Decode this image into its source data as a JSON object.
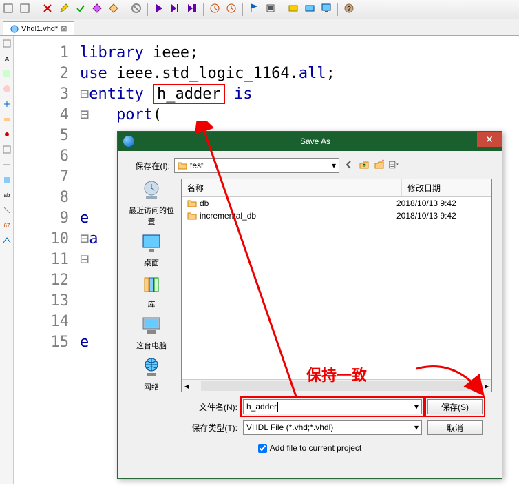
{
  "tab": {
    "label": "Vhdl1.vhd*"
  },
  "lines": {
    "nums": [
      "1",
      "2",
      "3",
      "4",
      "5",
      "6",
      "7",
      "8",
      "9",
      "10",
      "11",
      "12",
      "13",
      "14",
      "15"
    ]
  },
  "code": {
    "l1_kw1": "library",
    "l1_id1": " ieee",
    "l1_p1": ";",
    "l2_kw1": "use",
    "l2_id1": " ieee.std_logic_1164.",
    "l2_kw2": "all",
    "l2_p1": ";",
    "l3_kw1": "entity",
    "l3_box": "h_adder",
    "l3_kw2": " is",
    "l4_kw1": "port",
    "l4_p1": "(",
    "l9_id": "e",
    "l10_id": "a",
    "l15_id": "e"
  },
  "dialog": {
    "title": "Save As",
    "save_in_label": "保存在(I):",
    "save_in_value": "test",
    "cols": {
      "name": "名称",
      "date": "修改日期"
    },
    "rows": [
      {
        "name": "db",
        "date": "2018/10/13 9:42"
      },
      {
        "name": "incremental_db",
        "date": "2018/10/13 9:42"
      }
    ],
    "places": {
      "recent": "最近访问的位置",
      "desktop": "桌面",
      "libraries": "库",
      "computer": "这台电脑",
      "network": "网络"
    },
    "filename_label": "文件名(N):",
    "filename_value": "h_adder",
    "filetype_label": "保存类型(T):",
    "filetype_value": "VHDL File (*.vhd;*.vhdl)",
    "save_btn": "保存(S)",
    "cancel_btn": "取消",
    "checkbox_label": "Add file to current project"
  },
  "annotation": "保持一致"
}
